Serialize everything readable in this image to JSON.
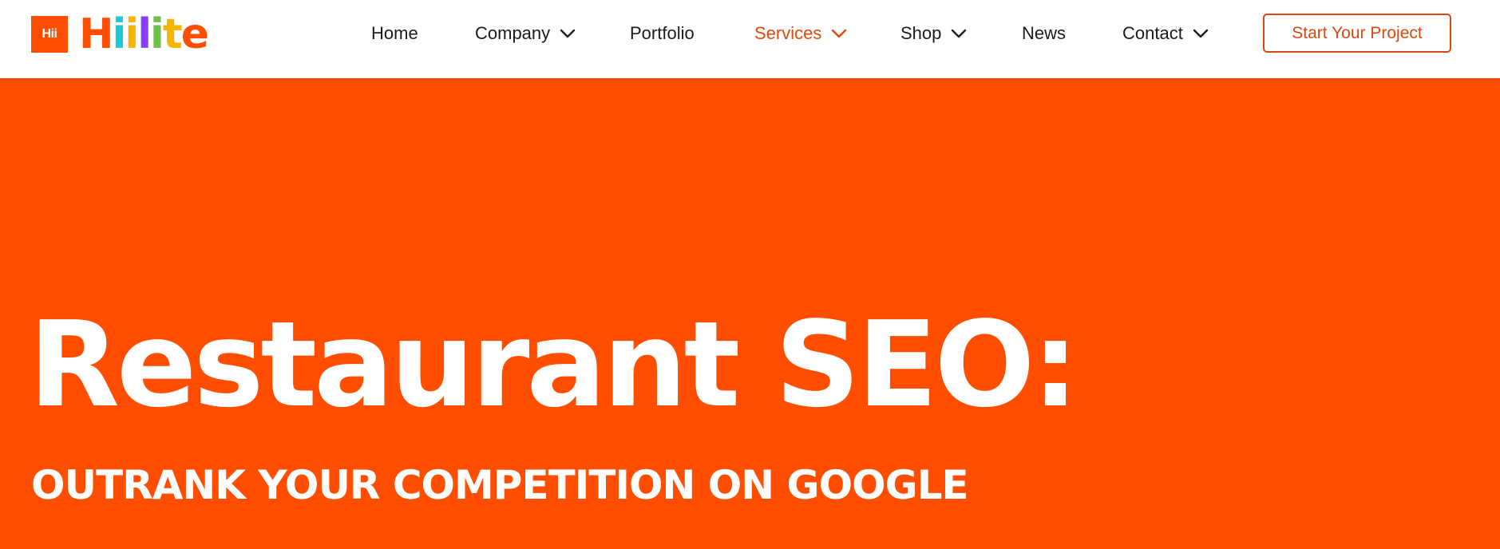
{
  "header": {
    "logo": {
      "badge_text": "Hii",
      "wordmark": "Hiilite",
      "badge_color": "#ff4e00",
      "letter_colors": [
        "#ff4e00",
        "#1ec8d8",
        "#f5b400",
        "#8a3ffc",
        "#6cc04a",
        "#f5b400",
        "#ff4e00"
      ]
    },
    "nav": [
      {
        "label": "Home",
        "dropdown": false,
        "active": false
      },
      {
        "label": "Company",
        "dropdown": true,
        "active": false
      },
      {
        "label": "Portfolio",
        "dropdown": false,
        "active": false
      },
      {
        "label": "Services",
        "dropdown": true,
        "active": true
      },
      {
        "label": "Shop",
        "dropdown": true,
        "active": false
      },
      {
        "label": "News",
        "dropdown": false,
        "active": false
      },
      {
        "label": "Contact",
        "dropdown": true,
        "active": false
      }
    ],
    "cta_label": "Start Your Project",
    "icons": {
      "dropdown": "chevron-down-icon"
    }
  },
  "hero": {
    "title": "Restaurant SEO:",
    "subtitle": "OUTRANK YOUR COMPETITION ON GOOGLE",
    "background_color": "#ff4e00"
  },
  "colors": {
    "accent": "#e24a0d",
    "nav_text": "#1b1b1b"
  }
}
